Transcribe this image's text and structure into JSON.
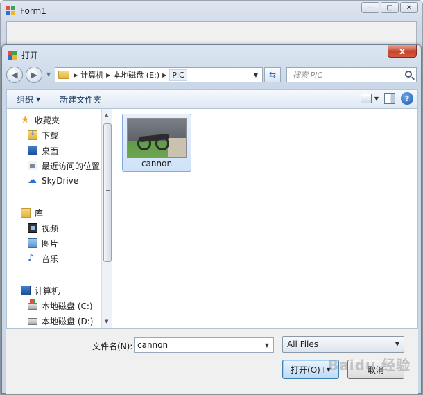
{
  "form1": {
    "title": "Form1"
  },
  "dialog": {
    "title": "打开",
    "close_glyph": "x",
    "breadcrumb": [
      "计算机",
      "本地磁盘 (E:)",
      "PIC"
    ],
    "search_placeholder": "搜索 PIC",
    "toolbar": {
      "organize": "组织",
      "new_folder": "新建文件夹",
      "help": "?"
    },
    "nav": {
      "favorites": "收藏夹",
      "favorites_items": [
        "下载",
        "桌面",
        "最近访问的位置",
        "SkyDrive"
      ],
      "libraries": "库",
      "libraries_items": [
        "视频",
        "图片",
        "音乐"
      ],
      "computer": "计算机",
      "computer_items": [
        "本地磁盘 (C:)",
        "本地磁盘 (D:)"
      ]
    },
    "files": [
      {
        "name": "cannon"
      }
    ],
    "filename_label": "文件名(N):",
    "filename_value": "cannon",
    "filetype_value": "All Files",
    "open_label": "打开(O)",
    "cancel_label": "取消",
    "watermark": "Baidu 经验"
  }
}
